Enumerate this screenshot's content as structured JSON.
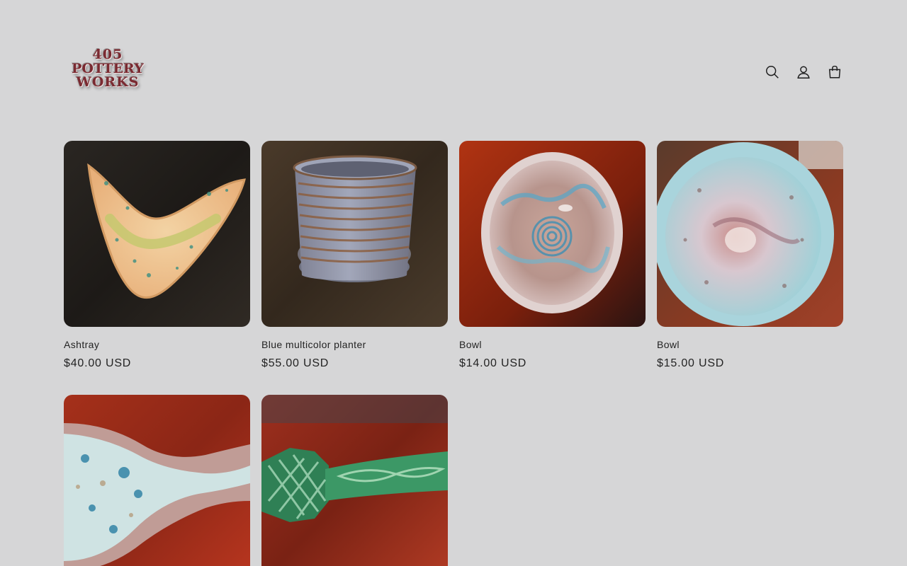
{
  "header": {
    "logo": {
      "line1": "405",
      "line2": "POTTERY",
      "line3": "WORKS"
    },
    "icons": [
      "search-icon",
      "account-icon",
      "cart-icon"
    ]
  },
  "products": [
    {
      "title": "Ashtray",
      "price": "$40.00 USD"
    },
    {
      "title": "Blue multicolor planter",
      "price": "$55.00 USD"
    },
    {
      "title": "Bowl",
      "price": "$14.00 USD"
    },
    {
      "title": "Bowl",
      "price": "$15.00 USD"
    },
    {
      "title": "",
      "price": ""
    },
    {
      "title": "",
      "price": ""
    }
  ],
  "colors": {
    "background": "#d6d6d7",
    "text": "#232323",
    "logo": "#7a2a31"
  }
}
